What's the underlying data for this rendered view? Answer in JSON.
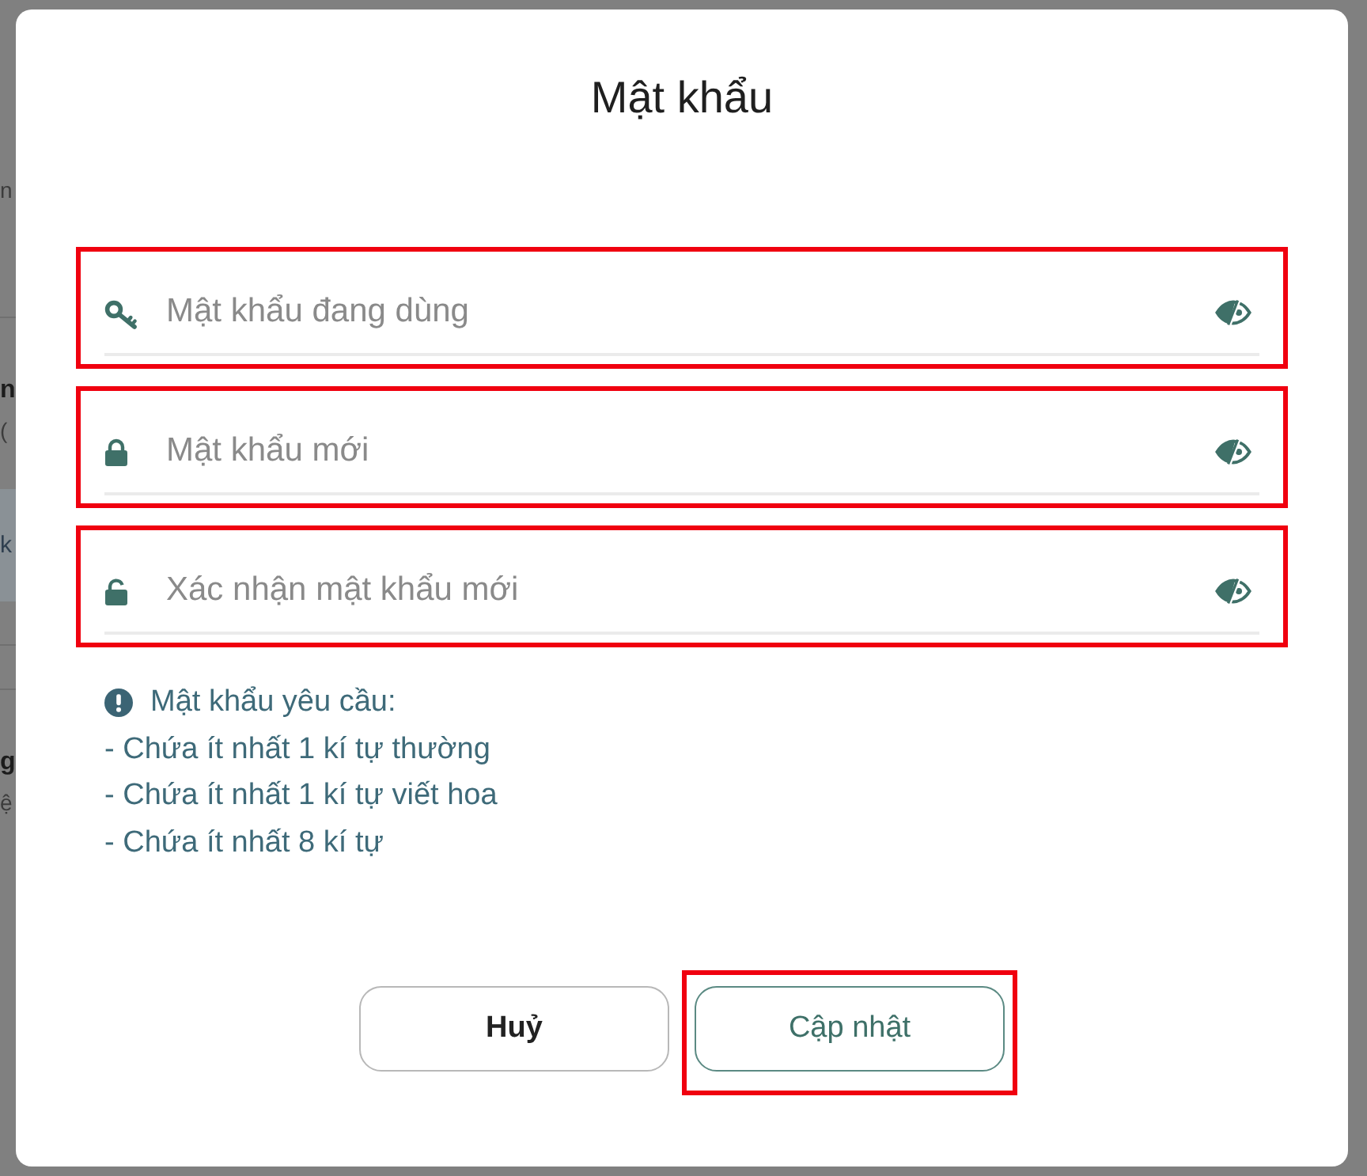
{
  "background": {
    "fragments": [
      "n",
      "n",
      "(",
      "k",
      "g",
      "ệ"
    ]
  },
  "dialog": {
    "title": "Mật khẩu",
    "fields": [
      {
        "kind": "key",
        "placeholder": "Mật khẩu đang dùng",
        "highlighted": true
      },
      {
        "kind": "lock",
        "placeholder": "Mật khẩu mới",
        "highlighted": true
      },
      {
        "kind": "unlock",
        "placeholder": "Xác nhận mật khẩu mới",
        "highlighted": true
      }
    ],
    "requirements": {
      "title": "Mật khẩu yêu cầu:",
      "items": [
        "- Chứa ít nhất 1 kí tự thường",
        "- Chứa ít nhất 1 kí tự viết hoa",
        "- Chứa ít nhất 8 kí tự"
      ]
    },
    "buttons": [
      {
        "kind": "secondary",
        "label": "Huỷ",
        "highlighted": false
      },
      {
        "kind": "primary",
        "label": "Cập nhật",
        "highlighted": true
      }
    ]
  }
}
